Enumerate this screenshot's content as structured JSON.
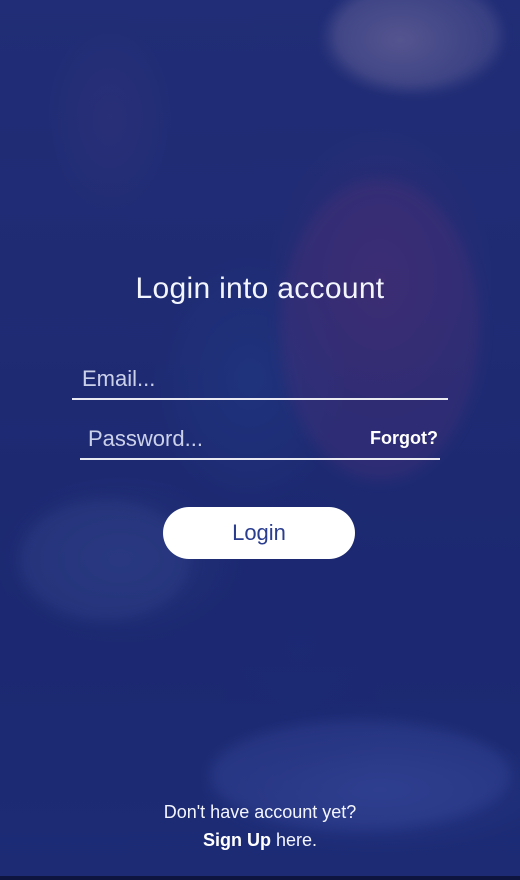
{
  "login": {
    "title": "Login into account",
    "email_placeholder": "Email...",
    "password_placeholder": "Password...",
    "forgot_label": "Forgot?",
    "login_button_label": "Login"
  },
  "footer": {
    "prompt": "Don't have account yet?",
    "signup_label": "Sign Up",
    "suffix": " here."
  },
  "colors": {
    "overlay": "#1d2d7a",
    "button_bg": "#ffffff",
    "button_text": "#2a3d8f"
  }
}
